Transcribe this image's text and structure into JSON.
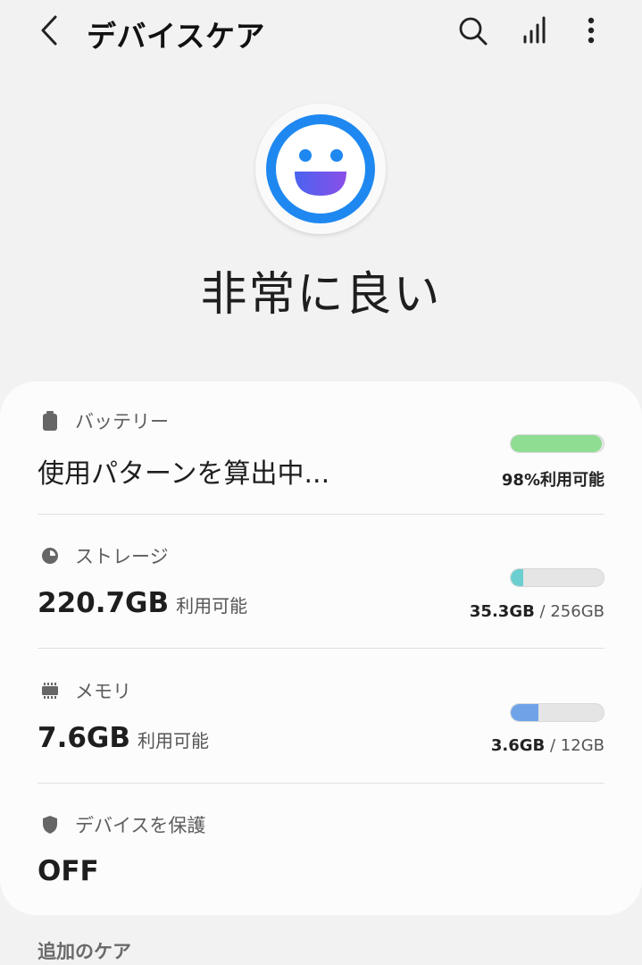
{
  "header": {
    "title": "デバイスケア",
    "icons": [
      "back-arrow-icon",
      "search-icon",
      "signal-bars-icon",
      "more-vert-icon"
    ]
  },
  "status": {
    "label": "非常に良い",
    "icon": "smiley-face-icon"
  },
  "battery": {
    "label": "バッテリー",
    "value": "使用パターンを算出中...",
    "usage": "98%利用可能",
    "level": 0.98,
    "color": "#8fdc93"
  },
  "storage": {
    "label": "ストレージ",
    "value": "220.7GB",
    "value_suffix": "利用可能",
    "used": "35.3GB",
    "total": "/ 256GB",
    "level": 0.138,
    "color": "#6ccfcf"
  },
  "memory": {
    "label": "メモリ",
    "value": "7.6GB",
    "value_suffix": "利用可能",
    "used": "3.6GB",
    "total": "/ 12GB",
    "level": 0.3,
    "color": "#6fa3e8"
  },
  "protection": {
    "label": "デバイスを保護",
    "value": "OFF"
  },
  "additional": {
    "label": "追加のケア"
  },
  "colors": {
    "accent": "#1e88f0",
    "background": "#f2f2f2",
    "card": "#fcfcfc"
  }
}
